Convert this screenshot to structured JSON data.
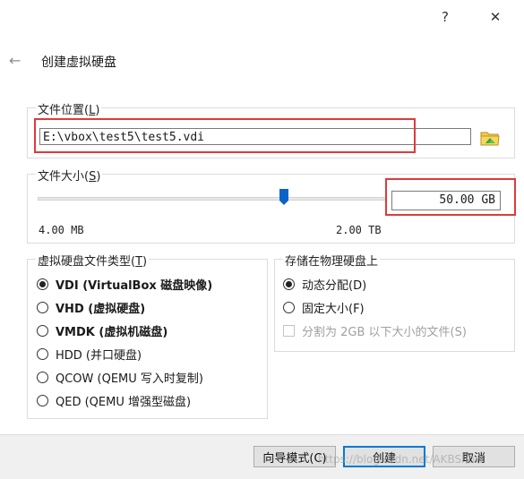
{
  "window": {
    "help_glyph": "?",
    "close_glyph": "✕",
    "back_glyph": "←"
  },
  "wizard": {
    "title": "创建虚拟硬盘"
  },
  "file_location": {
    "label": "文件位置(",
    "mnemonic": "L",
    "label_end": ")",
    "path_value": "E:\\vbox\\test5\\test5.vdi",
    "browse_icon": "folder-icon"
  },
  "file_size": {
    "label": "文件大小(",
    "mnemonic": "S",
    "label_end": ")",
    "value": "50.00 GB",
    "slider_min_label": "4.00 MB",
    "slider_max_label": "2.00 TB",
    "slider_position_fraction": 0.706
  },
  "disk_type": {
    "label": "虚拟硬盘文件类型(",
    "mnemonic": "T",
    "label_end": ")",
    "options": [
      {
        "label": "VDI (VirtualBox 磁盘映像)",
        "selected": true,
        "bold": true
      },
      {
        "label": "VHD (虚拟硬盘)",
        "selected": false,
        "bold": true
      },
      {
        "label": "VMDK (虚拟机磁盘)",
        "selected": false,
        "bold": true
      },
      {
        "label": "HDD (并口硬盘)",
        "selected": false,
        "bold": false
      },
      {
        "label": "QCOW (QEMU 写入时复制)",
        "selected": false,
        "bold": false
      },
      {
        "label": "QED (QEMU 增强型磁盘)",
        "selected": false,
        "bold": false
      }
    ]
  },
  "storage": {
    "label": "存储在物理硬盘上",
    "options": [
      {
        "label": "动态分配(D)",
        "selected": true
      },
      {
        "label": "固定大小(F)",
        "selected": false
      }
    ],
    "split_checkbox": {
      "label": "分割为 2GB 以下大小的文件(S)",
      "checked": false,
      "enabled": false
    }
  },
  "buttons": {
    "expert": "向导模式(C)",
    "create": "创建",
    "cancel": "取消"
  },
  "watermark": "https://blog.csdn.net/AKBShow"
}
